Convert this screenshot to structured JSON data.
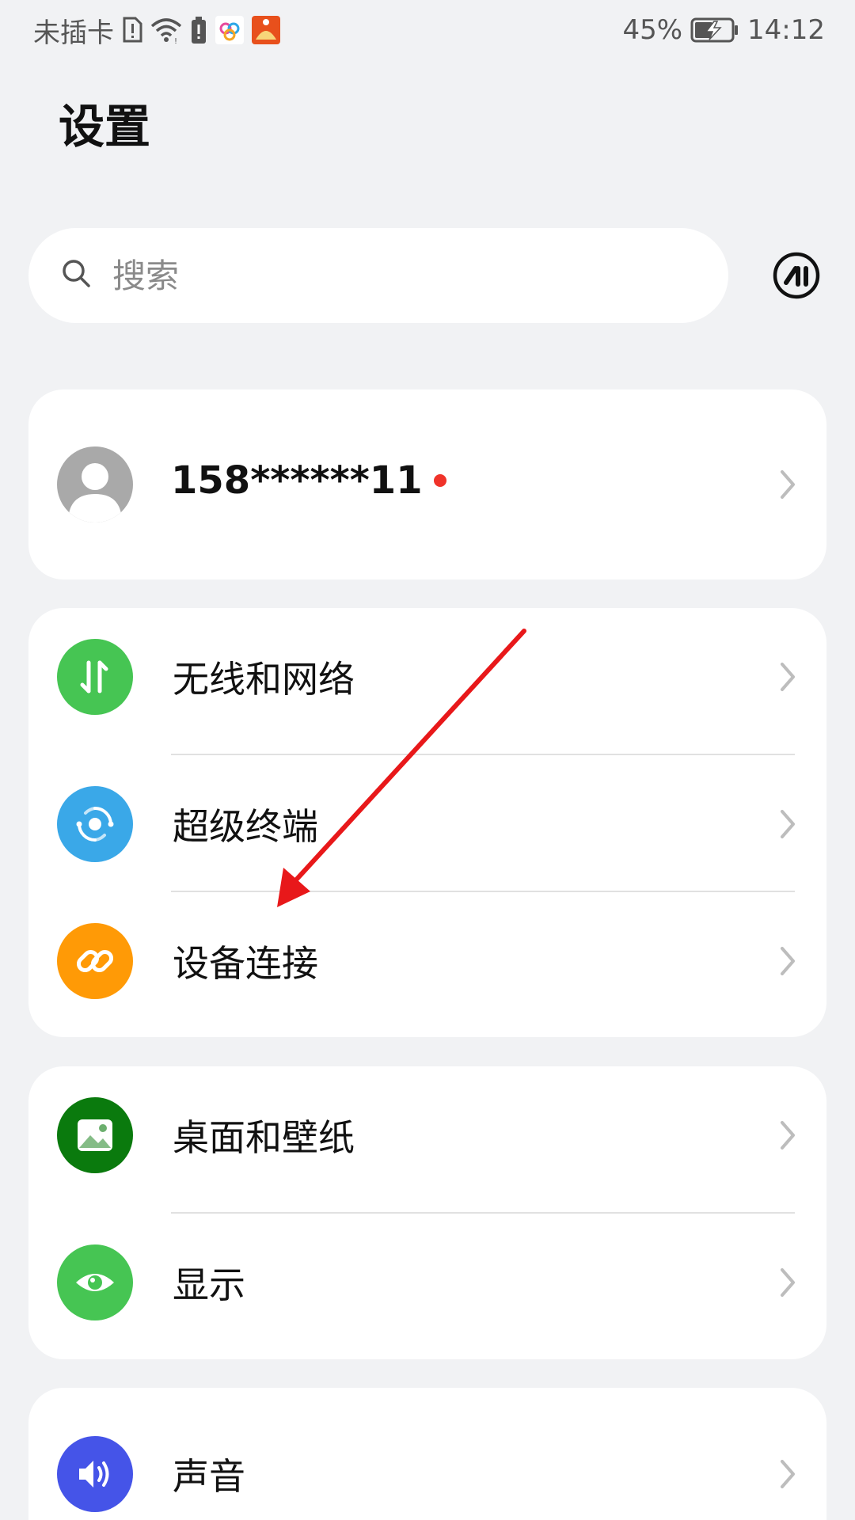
{
  "status_bar": {
    "carrier": "未插卡",
    "battery_percent": "45%",
    "time": "14:12",
    "icons": [
      "sim-alert-icon",
      "wifi-icon",
      "battery-alert-icon",
      "app-notification-icon",
      "app-notification-icon-2",
      "battery-charging-icon"
    ]
  },
  "header": {
    "title": "设置"
  },
  "search": {
    "placeholder": "搜索",
    "value": ""
  },
  "account": {
    "name": "158******11",
    "has_notification": true
  },
  "groups": [
    {
      "items": [
        {
          "label": "无线和网络",
          "icon": "wireless-network-icon",
          "color": "#46c553"
        },
        {
          "label": "超级终端",
          "icon": "super-device-icon",
          "color": "#3aa8e8"
        },
        {
          "label": "设备连接",
          "icon": "link-icon",
          "color": "#ff9a06"
        }
      ]
    },
    {
      "items": [
        {
          "label": "桌面和壁纸",
          "icon": "wallpaper-icon",
          "color": "#0a7a0d"
        },
        {
          "label": "显示",
          "icon": "eye-icon",
          "color": "#46c553"
        }
      ]
    },
    {
      "items": [
        {
          "label": "声音",
          "icon": "sound-icon",
          "color": "#4554e8"
        }
      ]
    }
  ],
  "annotation": {
    "color": "#e8181a"
  }
}
